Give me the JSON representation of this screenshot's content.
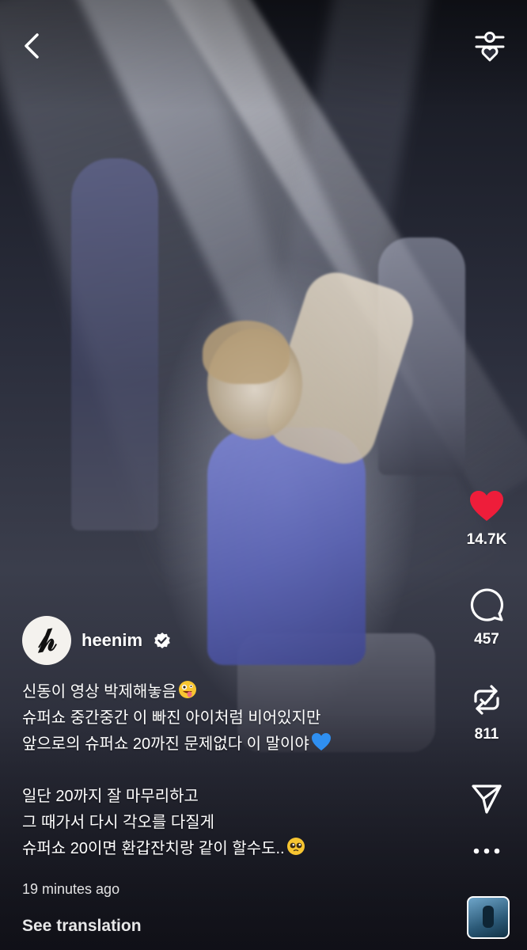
{
  "header": {
    "back_icon": "chevron-left-icon",
    "filter_icon": "heart-sliders-icon"
  },
  "actions": {
    "like": {
      "icon": "heart-filled-icon",
      "count": "14.7K",
      "color": "#ee1d3a",
      "liked": true
    },
    "comment": {
      "icon": "comment-bubble-icon",
      "count": "457"
    },
    "repost": {
      "icon": "repost-icon",
      "count": "811"
    },
    "share": {
      "icon": "paper-plane-icon"
    },
    "more": {
      "icon": "ellipsis-icon"
    }
  },
  "post": {
    "username": "heenim",
    "verified": true,
    "avatar_icon": "calligraphy-avatar",
    "caption_lines": [
      "신동이 영상 박제해놓음",
      "슈퍼쇼 중간중간 이 빠진 아이처럼 비어있지만",
      "앞으로의 슈퍼쇼 20까진 문제없다 이 말이야",
      "",
      "일단 20까지 잘 마무리하고",
      "그 때가서 다시 각오를 다질게",
      "슈퍼쇼 20이면 환갑잔치랑 같이 할수도.."
    ],
    "caption_emojis": {
      "line0": "zany-face-emoji",
      "line2": "blue-heart-emoji",
      "line6": "pleading-face-emoji"
    },
    "timestamp": "19 minutes ago",
    "see_translation": "See translation"
  },
  "audio_thumbnail": {
    "icon": "audio-cover-thumbnail"
  }
}
